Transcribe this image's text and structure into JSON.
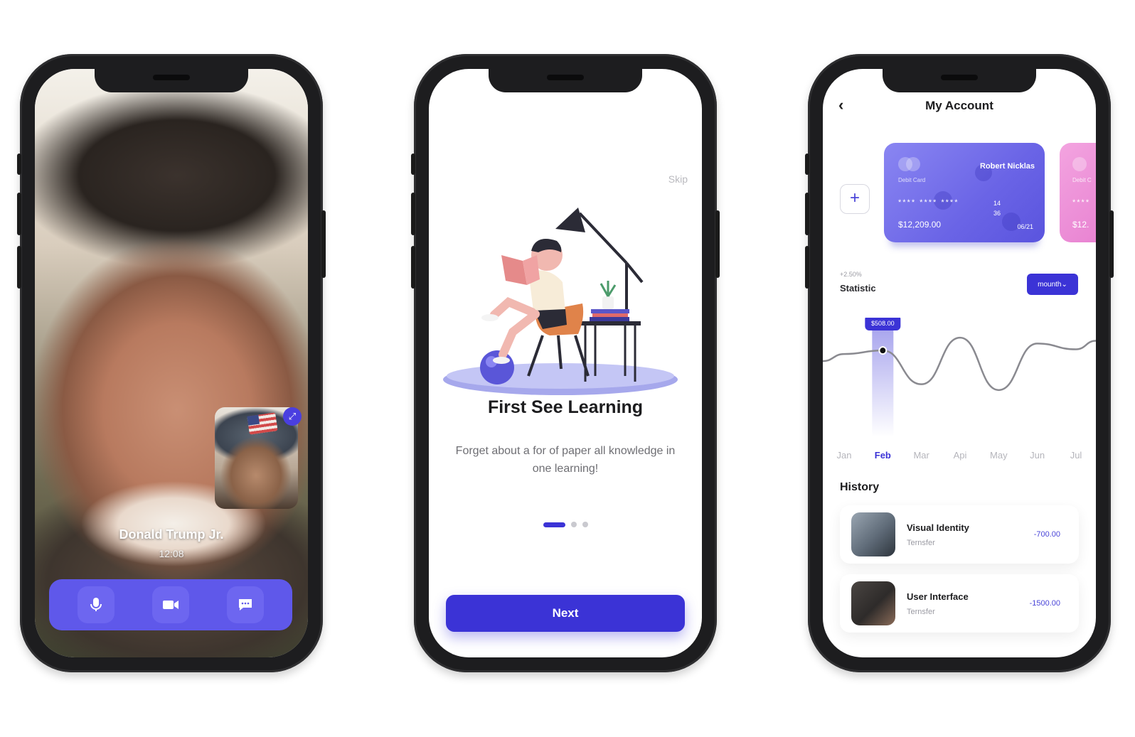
{
  "video_call": {
    "caller_name": "Donald Trump Jr.",
    "call_time": "12:08",
    "controls": [
      "microphone-icon",
      "video-camera-icon",
      "chat-icon"
    ],
    "accent_color": "#5f58ea"
  },
  "onboarding": {
    "skip_label": "Skip",
    "title": "First See Learning",
    "description": "Forget about a for of paper all knowledge in one learning!",
    "pages": 3,
    "active_page": 1,
    "next_label": "Next",
    "accent_color": "#3b33d6"
  },
  "account": {
    "title": "My Account",
    "add_label": "+",
    "cards": [
      {
        "type": "Debit Card",
        "holder": "Robert Nicklas",
        "number_masked": "**** **** ****",
        "number_last": "1436",
        "balance": "$12,209.00",
        "expiry": "06/21"
      },
      {
        "type": "Debit C",
        "number_masked": "****",
        "balance": "$12."
      }
    ],
    "statistic": {
      "change": "+2.50%",
      "label": "Statistic",
      "period": "mounth",
      "period_icon": "chevron-down-icon"
    },
    "history_title": "History",
    "history": [
      {
        "name": "Visual Identity",
        "sub": "Ternsfer",
        "amount": "-700.00"
      },
      {
        "name": "User Interface",
        "sub": "Ternsfer",
        "amount": "-1500.00"
      }
    ]
  },
  "chart_data": {
    "type": "line",
    "categories": [
      "Jan",
      "Feb",
      "Mar",
      "Api",
      "May",
      "Jun",
      "Jul"
    ],
    "highlight": {
      "category": "Feb",
      "label": "$508.00"
    },
    "series": [
      {
        "values": [
          502,
          508,
          450,
          530,
          440,
          520,
          510
        ]
      }
    ],
    "grid": false
  }
}
